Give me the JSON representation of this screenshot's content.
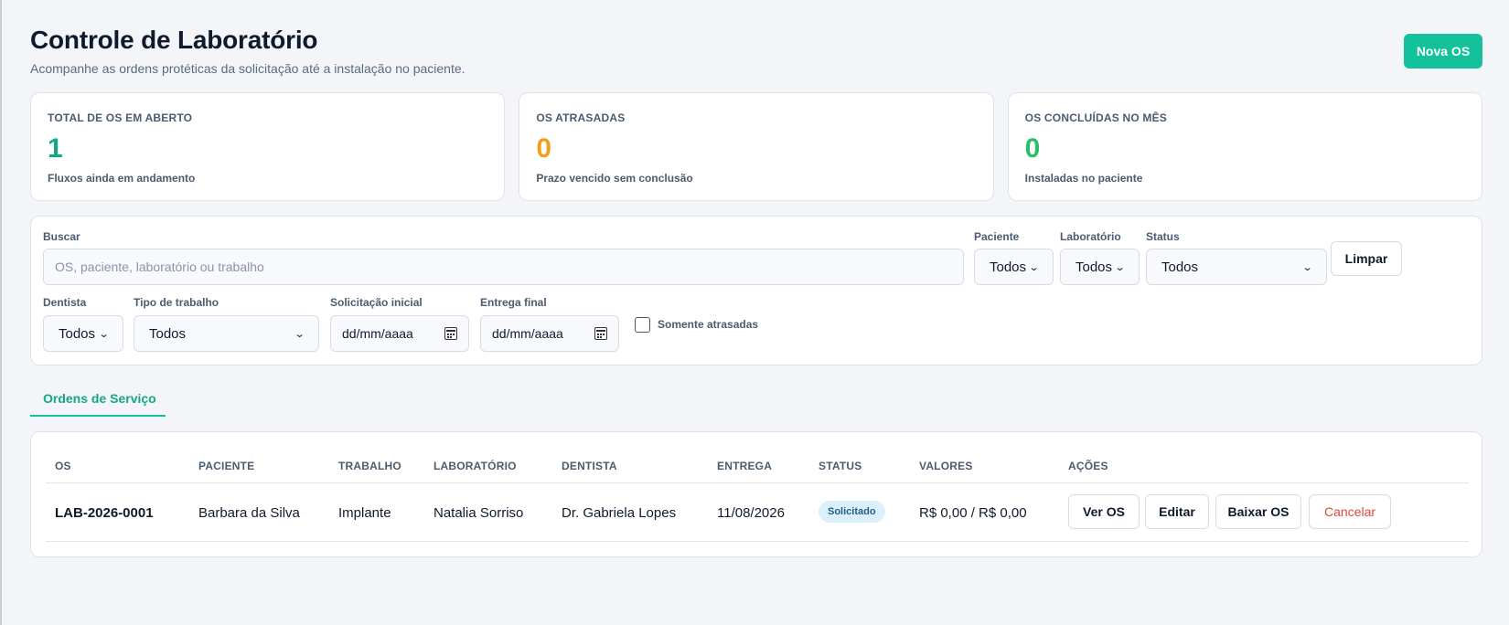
{
  "header": {
    "title": "Controle de Laboratório",
    "subtitle": "Acompanhe as ordens protéticas da solicitação até a instalação no paciente.",
    "new_button": "Nova OS"
  },
  "stats": [
    {
      "label": "TOTAL DE OS EM ABERTO",
      "value": "1",
      "desc": "Fluxos ainda em andamento",
      "color": "#13a882"
    },
    {
      "label": "OS ATRASADAS",
      "value": "0",
      "desc": "Prazo vencido sem conclusão",
      "color": "#f0a020"
    },
    {
      "label": "OS CONCLUÍDAS NO MÊS",
      "value": "0",
      "desc": "Instaladas no paciente",
      "color": "#2bbf6a"
    }
  ],
  "filters": {
    "search_label": "Buscar",
    "search_placeholder": "OS, paciente, laboratório ou trabalho",
    "paciente_label": "Paciente",
    "paciente_value": "Todos",
    "laboratorio_label": "Laboratório",
    "laboratorio_value": "Todos",
    "status_label": "Status",
    "status_value": "Todos",
    "clear_button": "Limpar",
    "dentista_label": "Dentista",
    "dentista_value": "Todos",
    "tipo_label": "Tipo de trabalho",
    "tipo_value": "Todos",
    "inicio_label": "Solicitação inicial",
    "inicio_value": "dd/mm/aaaa",
    "fim_label": "Entrega final",
    "fim_value": "dd/mm/aaaa",
    "atrasadas_label": "Somente atrasadas"
  },
  "tab": {
    "label": "Ordens de Serviço"
  },
  "table": {
    "headers": [
      "OS",
      "PACIENTE",
      "TRABALHO",
      "LABORATÓRIO",
      "DENTISTA",
      "ENTREGA",
      "STATUS",
      "VALORES",
      "AÇÕES"
    ],
    "rows": [
      {
        "os": "LAB-2026-0001",
        "paciente": "Barbara da Silva",
        "trabalho": "Implante",
        "laboratorio": "Natalia Sorriso",
        "dentista": "Dr. Gabriela Lopes",
        "entrega": "11/08/2026",
        "status": "Solicitado",
        "valores": "R$ 0,00 / R$ 0,00",
        "actions": {
          "ver": "Ver OS",
          "editar": "Editar",
          "baixar": "Baixar OS",
          "cancelar": "Cancelar"
        }
      }
    ]
  }
}
